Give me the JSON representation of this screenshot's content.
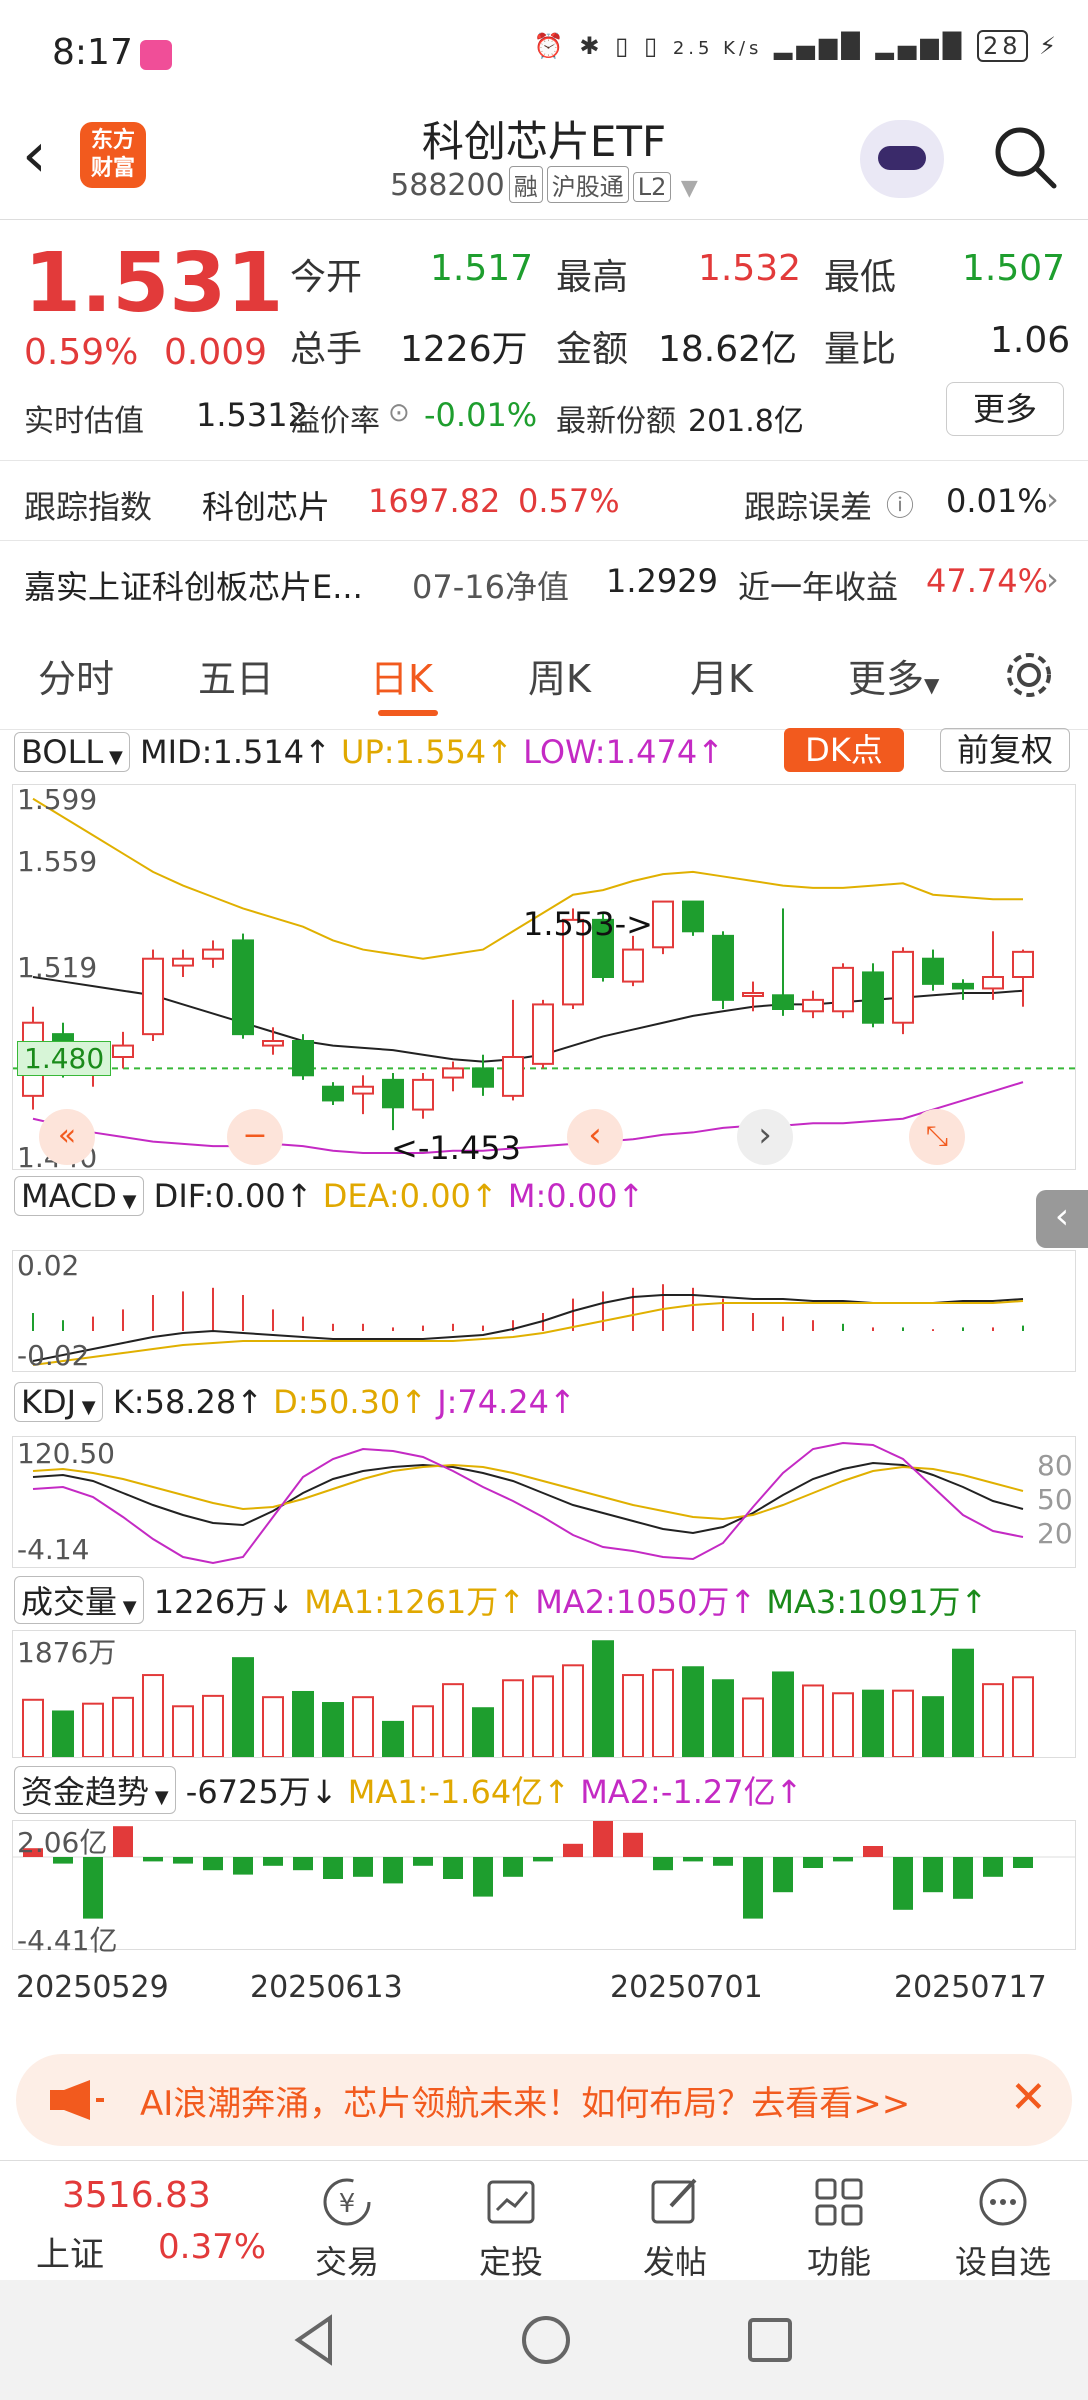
{
  "status": {
    "time": "8:17",
    "net_speed": "2.5 K/s",
    "battery": "28"
  },
  "header": {
    "title": "科创芯片ETF",
    "code": "588200",
    "tags": [
      "融",
      "沪股通",
      "L2"
    ],
    "logo_line1": "东方",
    "logo_line2": "财富"
  },
  "quote": {
    "price": "1.531",
    "change_pct": "0.59%",
    "change": "0.009",
    "open_label": "今开",
    "open": "1.517",
    "high_label": "最高",
    "high": "1.532",
    "low_label": "最低",
    "low": "1.507",
    "volume_label": "总手",
    "volume": "1226万",
    "amount_label": "金额",
    "amount": "18.62亿",
    "ratio_label": "量比",
    "ratio": "1.06",
    "iopv_label": "实时估值",
    "iopv": "1.5312",
    "premium_label": "溢价率",
    "premium": "-0.01%",
    "shares_label": "最新份额",
    "shares": "201.8亿",
    "more_label": "更多"
  },
  "tracking": {
    "label": "跟踪指数",
    "index_name": "科创芯片",
    "index_value": "1697.82",
    "index_pct": "0.57%",
    "error_label": "跟踪误差",
    "error": "0.01%"
  },
  "fund": {
    "name": "嘉实上证科创板芯片E...",
    "nav_date": "07-16净值",
    "nav": "1.2929",
    "return_label": "近一年收益",
    "return": "47.74%"
  },
  "tabs": [
    "分时",
    "五日",
    "日K",
    "周K",
    "月K",
    "更多"
  ],
  "active_tab": 2,
  "boll": {
    "name": "BOLL",
    "mid": "MID:1.514↑",
    "up": "UP:1.554↑",
    "low": "LOW:1.474↑",
    "dk_label": "DK点",
    "adjust_label": "前复权",
    "y_labels": [
      "1.599",
      "1.559",
      "1.519",
      "1.480",
      "1.440"
    ],
    "high_annot": "1.553->",
    "low_annot": "<-1.453",
    "price_line": "1.480"
  },
  "macd": {
    "name": "MACD",
    "dif": "DIF:0.00↑",
    "dea": "DEA:0.00↑",
    "m": "M:0.00↑",
    "y_top": "0.02",
    "y_bot": "-0.02"
  },
  "kdj": {
    "name": "KDJ",
    "k": "K:58.28↑",
    "d": "D:50.30↑",
    "j": "J:74.24↑",
    "y_top": "120.50",
    "y_bot": "-4.14",
    "levels": [
      "80",
      "50",
      "20"
    ]
  },
  "vol": {
    "name": "成交量",
    "value": "1226万↓",
    "ma1": "MA1:1261万↑",
    "ma2": "MA2:1050万↑",
    "ma3": "MA3:1091万↑",
    "y_top": "1876万"
  },
  "fund_flow": {
    "name": "资金趋势",
    "value": "-6725万↓",
    "ma1": "MA1:-1.64亿↑",
    "ma2": "MA2:-1.27亿↑",
    "y_top": "2.06亿",
    "y_bot": "-4.41亿"
  },
  "dates": [
    "20250529",
    "20250613",
    "20250701",
    "20250717"
  ],
  "banner": {
    "text": "AI浪潮奔涌，芯片领航未来！如何布局？去看看>>"
  },
  "bottom": {
    "index_value": "3516.83",
    "index_name": "上证",
    "index_pct": "0.37%",
    "items": [
      "交易",
      "定投",
      "发帖",
      "功能",
      "自选"
    ],
    "self_select": "设自选"
  },
  "chart_data": {
    "type": "candlestick",
    "candles": [
      [
        1.468,
        1.5,
        1.462,
        1.507
      ],
      [
        1.495,
        1.48,
        1.476,
        1.5
      ],
      [
        1.478,
        1.482,
        1.472,
        1.489
      ],
      [
        1.485,
        1.49,
        1.48,
        1.496
      ],
      [
        1.495,
        1.528,
        1.492,
        1.532
      ],
      [
        1.525,
        1.528,
        1.52,
        1.532
      ],
      [
        1.528,
        1.532,
        1.524,
        1.536
      ],
      [
        1.536,
        1.495,
        1.493,
        1.539
      ],
      [
        1.49,
        1.492,
        1.486,
        1.498
      ],
      [
        1.492,
        1.477,
        1.475,
        1.495
      ],
      [
        1.472,
        1.466,
        1.464,
        1.474
      ],
      [
        1.469,
        1.472,
        1.46,
        1.477
      ],
      [
        1.475,
        1.463,
        1.453,
        1.478
      ],
      [
        1.462,
        1.475,
        1.458,
        1.478
      ],
      [
        1.476,
        1.48,
        1.47,
        1.483
      ],
      [
        1.48,
        1.472,
        1.468,
        1.486
      ],
      [
        1.468,
        1.485,
        1.466,
        1.51
      ],
      [
        1.482,
        1.508,
        1.48,
        1.51
      ],
      [
        1.508,
        1.545,
        1.506,
        1.55
      ],
      [
        1.545,
        1.52,
        1.518,
        1.548
      ],
      [
        1.518,
        1.532,
        1.516,
        1.538
      ],
      [
        1.533,
        1.553,
        1.53,
        1.553
      ],
      [
        1.553,
        1.54,
        1.538,
        1.553
      ],
      [
        1.538,
        1.51,
        1.506,
        1.54
      ],
      [
        1.512,
        1.513,
        1.505,
        1.518
      ],
      [
        1.512,
        1.506,
        1.503,
        1.55
      ],
      [
        1.505,
        1.51,
        1.502,
        1.514
      ],
      [
        1.505,
        1.524,
        1.502,
        1.526
      ],
      [
        1.522,
        1.5,
        1.498,
        1.526
      ],
      [
        1.5,
        1.531,
        1.495,
        1.533
      ],
      [
        1.528,
        1.517,
        1.514,
        1.532
      ],
      [
        1.517,
        1.515,
        1.51,
        1.519
      ],
      [
        1.515,
        1.52,
        1.51,
        1.54
      ],
      [
        1.52,
        1.531,
        1.507,
        1.532
      ]
    ],
    "boll_up": [
      1.598,
      1.59,
      1.582,
      1.574,
      1.566,
      1.56,
      1.555,
      1.55,
      1.546,
      1.542,
      1.536,
      1.532,
      1.53,
      1.528,
      1.53,
      1.532,
      1.54,
      1.548,
      1.556,
      1.558,
      1.562,
      1.565,
      1.566,
      1.564,
      1.562,
      1.56,
      1.559,
      1.559,
      1.56,
      1.561,
      1.556,
      1.555,
      1.554,
      1.554
    ],
    "boll_mid": [
      1.52,
      1.518,
      1.516,
      1.514,
      1.512,
      1.508,
      1.504,
      1.5,
      1.496,
      1.492,
      1.49,
      1.489,
      1.488,
      1.486,
      1.484,
      1.483,
      1.484,
      1.486,
      1.49,
      1.494,
      1.497,
      1.5,
      1.503,
      1.505,
      1.507,
      1.508,
      1.508,
      1.509,
      1.51,
      1.511,
      1.512,
      1.513,
      1.513,
      1.514
    ],
    "boll_low": [
      1.458,
      1.455,
      1.452,
      1.45,
      1.448,
      1.447,
      1.446,
      1.446,
      1.447,
      1.446,
      1.444,
      1.443,
      1.443,
      1.443,
      1.444,
      1.444,
      1.445,
      1.446,
      1.447,
      1.448,
      1.449,
      1.451,
      1.452,
      1.454,
      1.455,
      1.455,
      1.456,
      1.456,
      1.457,
      1.458,
      1.462,
      1.466,
      1.47,
      1.474
    ],
    "volume_wan": [
      880,
      700,
      820,
      910,
      1260,
      780,
      940,
      1520,
      920,
      1000,
      830,
      920,
      540,
      780,
      1120,
      750,
      1180,
      1240,
      1410,
      1780,
      1260,
      1340,
      1380,
      1180,
      900,
      1300,
      1100,
      980,
      1020,
      1020,
      920,
      1650,
      1120,
      1226
    ]
  }
}
